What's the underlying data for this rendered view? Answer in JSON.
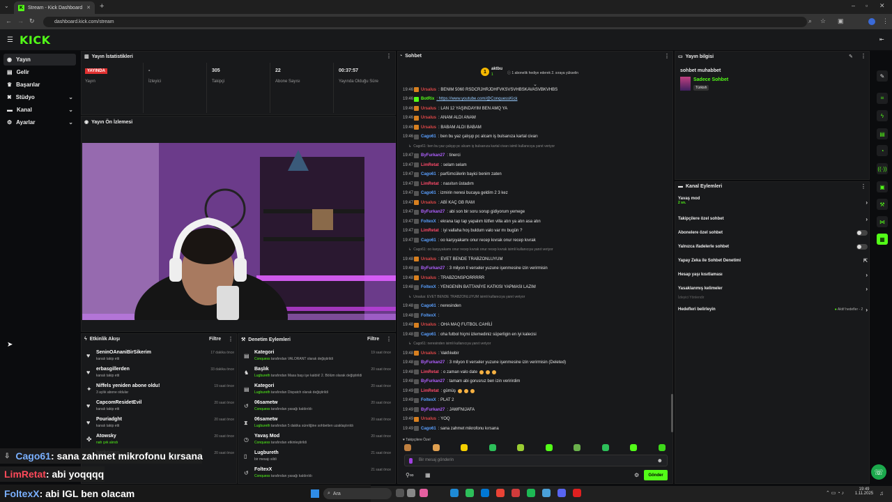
{
  "browser": {
    "tab_title": "Stream - Kick Dashboard",
    "url": "dashboard.kick.com/stream"
  },
  "header": {
    "logo": "KICK"
  },
  "sidebar": {
    "items": [
      {
        "label": "Yayın",
        "icon": "broadcast-icon"
      },
      {
        "label": "Gelir",
        "icon": "wallet-icon"
      },
      {
        "label": "Başarılar",
        "icon": "trophy-icon"
      },
      {
        "label": "Stüdyo",
        "icon": "studio-icon"
      },
      {
        "label": "Kanal",
        "icon": "channel-icon"
      },
      {
        "label": "Ayarlar",
        "icon": "gear-icon"
      }
    ]
  },
  "stats": {
    "title": "Yayın İstatistikleri",
    "live_badge": "YAYINDA",
    "cells": [
      {
        "value": "",
        "label": "Yayın"
      },
      {
        "value": "-",
        "label": "İzleyici"
      },
      {
        "value": "305",
        "label": "Takipçi"
      },
      {
        "value": "22",
        "label": "Abone Sayısı"
      },
      {
        "value": "00:37:57",
        "label": "Yayında Olduğu Süre"
      }
    ]
  },
  "preview": {
    "title": "Yayın Ön İzlemesi"
  },
  "activity": {
    "title": "Etkinlik Akışı",
    "filter": "Filtre",
    "rows": [
      {
        "name": "SeninOAnaniBirSikerim",
        "desc": "kanalı takip etti",
        "time": "17 dakika önce",
        "icon": "heart-icon"
      },
      {
        "name": "erbasgillerden",
        "desc": "kanalı takip etti",
        "time": "33 dakika önce",
        "icon": "heart-icon"
      },
      {
        "name": "Niffels yeniden abone oldu!",
        "desc": "3 aylık abone oldular",
        "time": "19 saat önce",
        "icon": "star-icon"
      },
      {
        "name": "CapcomResidetEvil",
        "desc": "kanalı takip etti",
        "time": "20 saat önce",
        "icon": "heart-icon"
      },
      {
        "name": "Pouriadght",
        "desc": "kanalı takip etti",
        "time": "20 saat önce",
        "icon": "heart-icon"
      },
      {
        "name": "Atowsky",
        "desc": "nah çek alındı",
        "time": "20 saat önce",
        "icon": "gift-icon"
      },
      {
        "name": "berkoman",
        "desc": "",
        "time": "20 saat önce",
        "icon": "heart-icon"
      }
    ]
  },
  "moderation": {
    "title": "Denetim Eylemleri",
    "filter": "Filtre",
    "rows": [
      {
        "name": "Kategori",
        "actor": "Conquess",
        "desc": "tarafından VALORANT olarak değiştirildi",
        "time": "19 saat önce"
      },
      {
        "name": "Başlık",
        "actor": "Lugbureth",
        "desc": "tarafından Masa başı işe kaldık! 2. Bölüm olarak değiştirildi",
        "time": "20 saat önce"
      },
      {
        "name": "Kategori",
        "actor": "Lugbureth",
        "desc": "tarafından Dispatch olarak değiştirildi",
        "time": "20 saat önce"
      },
      {
        "name": "06sametw",
        "actor": "Conquess",
        "desc": "tarafından yasağı kaldırıldı",
        "time": "20 saat önce"
      },
      {
        "name": "06sametw",
        "actor": "Lugbureth",
        "desc": "tarafından 5 dakika süreliğine sohbetten uzaklaştırıldı",
        "time": "20 saat önce"
      },
      {
        "name": "Yavaş Mod",
        "actor": "Conquess",
        "desc": "tarafından etkinleştirildi",
        "time": "20 saat önce"
      },
      {
        "name": "Lugbureth",
        "actor": "",
        "desc": "bir mesajı sildi",
        "time": "21 saat önce"
      },
      {
        "name": "FoltexX",
        "actor": "Conquess",
        "desc": "tarafından yasağı kaldırıldı",
        "time": "21 saat önce"
      }
    ]
  },
  "chat": {
    "title": "Sohbet",
    "pinned_user": "aktbu",
    "pinned_count": "1",
    "pinned_text": "1 abonelik hediye ederek 2. sıraya yükselin",
    "lines": [
      {
        "t": "19:46",
        "u": "Ursalus",
        "c": "#e04848",
        "m": ": BENIM 5060 RSDCRJHRJDHFVKSVSVHBSKAVASVBKVHBS"
      },
      {
        "t": "19:46",
        "u": "BotRix",
        "c": "#53fc18",
        "m": ": https://www.youtube.com/@ConquessKick"
      },
      {
        "t": "19:46",
        "u": "Ursalus",
        "c": "#e04848",
        "m": ": LAN 12 YAŞINDAYIM BEN AMQ YA"
      },
      {
        "t": "19:46",
        "u": "Ursalus",
        "c": "#e04848",
        "m": ": ANAM ALDI ANAM"
      },
      {
        "t": "19:46",
        "u": "Ursalus",
        "c": "#e04848",
        "m": ": BABAM ALDI BABAM"
      },
      {
        "t": "19:46",
        "u": "Cago61",
        "c": "#5aa0ff",
        "m": ": ben bu yaz çalışıp pc alcam iş bulsanıza kartal civarı"
      },
      {
        "t": "",
        "u": "",
        "c": "#888",
        "m": "Cago61: ben bu yaz çalışıp pc alcam iş bulsanıza kartal civarı isimli kullanıcıya yanıt veriyor",
        "reply": true
      },
      {
        "t": "19:47",
        "u": "ByFurkan27",
        "c": "#b060ff",
        "m": ": tinerci"
      },
      {
        "t": "19:47",
        "u": "LimRetat",
        "c": "#ff4a6a",
        "m": ": selam selam"
      },
      {
        "t": "19:47",
        "u": "Cago61",
        "c": "#5aa0ff",
        "m": ": parfümcülerin bayici benim zaten"
      },
      {
        "t": "19:47",
        "u": "LimRetat",
        "c": "#ff4a6a",
        "m": ": nasılsın üstadım"
      },
      {
        "t": "19:47",
        "u": "Cago61",
        "c": "#5aa0ff",
        "m": ": izmirin neresi bucaya geldim 2 3 kez"
      },
      {
        "t": "19:47",
        "u": "Ursalus",
        "c": "#e04848",
        "m": ": ABİ KAÇ GB RAM"
      },
      {
        "t": "19:47",
        "u": "ByFurkan27",
        "c": "#b060ff",
        "m": ": abi son bir soru sorup gidiyorum yemege"
      },
      {
        "t": "19:47",
        "u": "FoltexX",
        "c": "#5aa0ff",
        "m": ": ekrana tap tap yapalım lütfen villa atın ya atın asa atın"
      },
      {
        "t": "19:47",
        "u": "LimRetat",
        "c": "#ff4a6a",
        "m": ": iyi vallaha hoş buldum valo var mı bugün ?"
      },
      {
        "t": "19:47",
        "u": "Cago61",
        "c": "#5aa0ff",
        "m": ": oo karşıyakamı onur recep kıvrak onur recep kıvrak"
      },
      {
        "t": "",
        "u": "",
        "c": "#888",
        "m": "Cago61: oo karşıyakamı onur recep kıvrak onur recep kıvrak isimli kullanıcıya yanıt veriyor",
        "reply": true
      },
      {
        "t": "19:48",
        "u": "Ursalus",
        "c": "#e04848",
        "m": ": EVET BENDE TRABZONLUYUM"
      },
      {
        "t": "19:48",
        "u": "ByFurkan27",
        "c": "#b060ff",
        "m": ": 3 milyon tl verseler yuzune işenmesine izin verirmisin"
      },
      {
        "t": "19:48",
        "u": "Ursalus",
        "c": "#e04848",
        "m": ": TRABZONSPORRRRR"
      },
      {
        "t": "19:48",
        "u": "FoltexX",
        "c": "#5aa0ff",
        "m": ": YENGENİN BATTANİYE KATKISI YAPMASI LAZIM"
      },
      {
        "t": "",
        "u": "",
        "c": "#888",
        "m": "Ursalus: EVET BENDE TRABZONLUYUM isimli kullanıcıya yanıt veriyor",
        "reply": true
      },
      {
        "t": "19:48",
        "u": "Cago61",
        "c": "#5aa0ff",
        "m": ": neresinden"
      },
      {
        "t": "19:48",
        "u": "FoltexX",
        "c": "#5aa0ff",
        "m": ":"
      },
      {
        "t": "19:48",
        "u": "Ursalus",
        "c": "#e04848",
        "m": ": OHA MAQ FUTBOL CAHİLİ"
      },
      {
        "t": "19:48",
        "u": "Cago61",
        "c": "#5aa0ff",
        "m": ": oha futbol hiçmi izlemediniz süperligin en iyi kalecisi"
      },
      {
        "t": "",
        "u": "",
        "c": "#888",
        "m": "Cago61: neresinden isimli kullanıcıya yanıt veriyor",
        "reply": true
      },
      {
        "t": "19:48",
        "u": "Ursalus",
        "c": "#e04848",
        "m": ": Vakfıkebir"
      },
      {
        "t": "19:48",
        "u": "ByFurkan27",
        "c": "#b060ff",
        "m": ": 3 milyon tl verseler yuzune işenmesine izin verirmisin (Deleted)"
      },
      {
        "t": "19:48",
        "u": "LimRetat",
        "c": "#ff4a6a",
        "m": ": o zaman valo date"
      },
      {
        "t": "19:48",
        "u": "ByFurkan27",
        "c": "#b060ff",
        "m": ": tamam abi gorusruz ben izin veririrdim"
      },
      {
        "t": "19:49",
        "u": "LimRetat",
        "c": "#ff4a6a",
        "m": ": gümüş"
      },
      {
        "t": "19:49",
        "u": "FoltexX",
        "c": "#5aa0ff",
        "m": ": PLAT 2"
      },
      {
        "t": "19:49",
        "u": "ByFurkan27",
        "c": "#b060ff",
        "m": ": JAWFNIJAFA"
      },
      {
        "t": "19:49",
        "u": "Ursalus",
        "c": "#e04848",
        "m": ": YOQ"
      },
      {
        "t": "19:49",
        "u": "Cago61",
        "c": "#5aa0ff",
        "m": ": sana zahmet mikrofonu kırsana"
      },
      {
        "t": "19:49",
        "u": "LimRetat",
        "c": "#ff4a6a",
        "m": ": abi yoqqqq"
      },
      {
        "t": "19:49",
        "u": "FoltexX",
        "c": "#5aa0ff",
        "m": ": abi IGL ben olacam"
      }
    ],
    "followers_only": "Takipçilere Özel",
    "input_placeholder": "Bir mesaj gönderin",
    "send": "Gönder"
  },
  "stream_info": {
    "title": "Yayın bilgisi",
    "stream_title": "sohbet muhabbet",
    "category": "Sadece Sohbet",
    "tag": "Türkish"
  },
  "channel_actions": {
    "title": "Kanal Eylemleri",
    "slow_mode": "Yavaş mod",
    "slow_mode_value": "2 sn.",
    "items": [
      {
        "label": "Takipçilere özel sohbet",
        "control": "chevron"
      },
      {
        "label": "Abonelere özel sohbet",
        "control": "toggle"
      },
      {
        "label": "Yalnızca ifadelerle sohbet",
        "control": "toggle"
      },
      {
        "label": "Yapay Zeka ile Sohbet Denetimi",
        "control": "external"
      },
      {
        "label": "Hesap yaşı kısıtlaması",
        "control": "chevron"
      },
      {
        "label": "Yasaklanmış kelimeler",
        "control": "chevron"
      }
    ],
    "viewer_section": "İzleyici Yönlendir",
    "goals": "Hedefleri belirleyin",
    "goals_status": "Aktif hedefler - 2"
  },
  "overlay": [
    {
      "user": "Cago61",
      "color": "#7ab0ff",
      "msg": ": sana zahmet mikrofonu kırsana"
    },
    {
      "user": "LimRetat",
      "color": "#ff4a5a",
      "msg": ": abi yoqqqq"
    },
    {
      "user": "FoltexX",
      "color": "#7ab0ff",
      "msg": ": abi IGL ben olacam"
    }
  ],
  "taskbar": {
    "search": "Ara",
    "time": "19:49",
    "date": "1.11.2025"
  }
}
